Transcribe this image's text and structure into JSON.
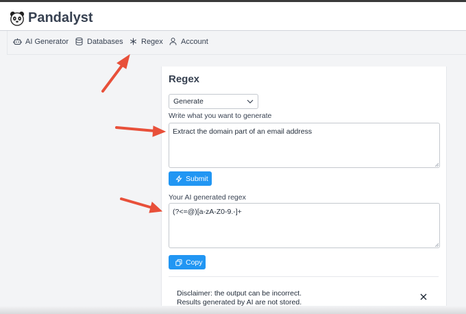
{
  "app": {
    "title": "Pandalyst"
  },
  "nav": {
    "items": [
      {
        "label": "AI Generator",
        "icon": "robot-icon"
      },
      {
        "label": "Databases",
        "icon": "database-icon"
      },
      {
        "label": "Regex",
        "icon": "asterisk-icon"
      },
      {
        "label": "Account",
        "icon": "user-icon"
      }
    ]
  },
  "regex": {
    "title": "Regex",
    "mode_select": {
      "value": "Generate"
    },
    "prompt_label": "Write what you want to generate",
    "prompt_value": "Extract the domain part of an email address",
    "submit_label": "Submit",
    "result_label": "Your AI generated regex",
    "result_value": "(?<=@)[a-zA-Z0-9.-]+",
    "copy_label": "Copy",
    "disclaimer_line1": "Disclaimer: the output can be incorrect.",
    "disclaimer_line2": "Results generated by AI are not stored."
  },
  "colors": {
    "accent": "#2196f3",
    "annotation_arrow": "#e8503a"
  }
}
